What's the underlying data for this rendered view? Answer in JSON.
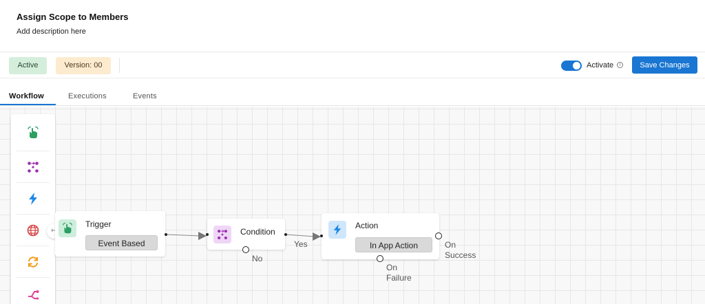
{
  "header": {
    "title": "Assign Scope to Members",
    "description": "Add description here"
  },
  "toolbar": {
    "status_badge": "Active",
    "version_badge": "Version: 00",
    "activate_label": "Activate",
    "activate_on": true,
    "info_glyph": "i",
    "save_label": "Save Changes"
  },
  "tabs": [
    {
      "label": "Workflow",
      "active": true
    },
    {
      "label": "Executions",
      "active": false
    },
    {
      "label": "Events",
      "active": false
    }
  ],
  "palette": {
    "items": [
      {
        "icon": "hand-tap-icon",
        "color": "#2e9e63"
      },
      {
        "icon": "condition-grid-icon",
        "color": "#9b2fae"
      },
      {
        "icon": "lightning-icon",
        "color": "#1e88e5"
      },
      {
        "icon": "globe-icon",
        "color": "#d84343"
      },
      {
        "icon": "refresh-icon",
        "color": "#f29b18"
      },
      {
        "icon": "branch-icon",
        "color": "#e24597"
      }
    ]
  },
  "canvas": {
    "entry_handle_glyph": "↦",
    "nodes": {
      "trigger": {
        "title": "Trigger",
        "chip": "Event Based",
        "icon": "hand-tap-icon"
      },
      "condition": {
        "title": "Condition",
        "icon": "condition-grid-icon",
        "no_label": "No",
        "yes_label": "Yes"
      },
      "action": {
        "title": "Action",
        "chip": "In App Action",
        "icon": "lightning-icon",
        "success_label_1": "On",
        "success_label_2": "Success",
        "failure_label_1": "On",
        "failure_label_2": "Failure"
      }
    }
  },
  "colors": {
    "accent": "#1976d2",
    "active_badge_bg": "#d4eedb",
    "version_badge_bg": "#fdebcf"
  }
}
